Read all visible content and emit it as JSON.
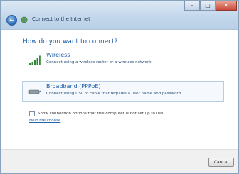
{
  "window": {
    "title": "Connect to the Internet",
    "caption_buttons": {
      "minimize": "–",
      "maximize": "□",
      "close": "✕"
    },
    "back_glyph": "←"
  },
  "main": {
    "heading": "How do you want to connect?",
    "options": [
      {
        "title": "Wireless",
        "description": "Connect using a wireless router or a wireless network.",
        "icon": "wireless-signal-icon"
      },
      {
        "title": "Broadband (PPPoE)",
        "description": "Connect using DSL or cable that requires a user name and password.",
        "icon": "broadband-modem-icon"
      }
    ],
    "checkbox_label": "Show connection options that this computer is not set up to use",
    "help_link": "Help me choose"
  },
  "footer": {
    "cancel_label": "Cancel"
  },
  "colors": {
    "heading": "#1e5fa8",
    "link": "#1e62b0",
    "close_button": "#c8493a"
  }
}
